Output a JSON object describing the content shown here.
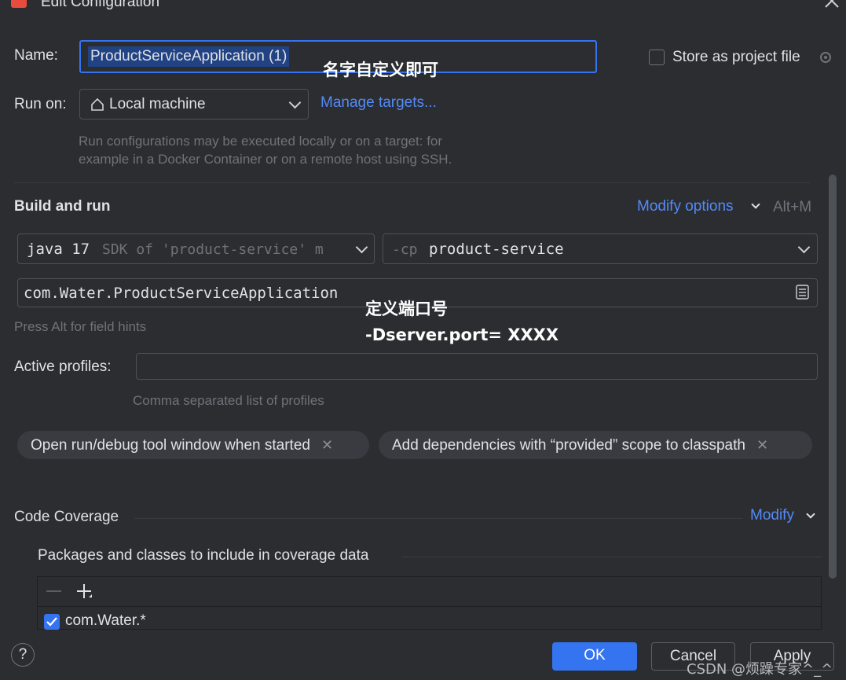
{
  "window": {
    "title": "Edit Configuration"
  },
  "name_field": {
    "label": "Name:",
    "value": "ProductServiceApplication (1)"
  },
  "store_option": {
    "label": "Store as project file"
  },
  "run_on": {
    "label": "Run on:",
    "value": "Local machine",
    "manage_link": "Manage targets...",
    "hint_line1": "Run configurations may be executed locally or on a target: for",
    "hint_line2": "example in a Docker Container or on a remote host using SSH."
  },
  "build_run": {
    "title": "Build and run",
    "modify_options": "Modify options",
    "shortcut": "Alt+M",
    "jdk_value": "java 17",
    "jdk_hint": "SDK of 'product-service' m",
    "cp_prefix": "-cp",
    "cp_value": "product-service",
    "main_class": "com.Water.ProductServiceApplication",
    "field_hint": "Press Alt for field hints"
  },
  "profiles": {
    "label": "Active profiles:",
    "value": "",
    "hint": "Comma separated list of profiles"
  },
  "chips": [
    {
      "label": "Open run/debug tool window when started"
    },
    {
      "label": "Add dependencies with “provided” scope to classpath"
    }
  ],
  "coverage": {
    "title": "Code Coverage",
    "modify": "Modify",
    "packages_title": "Packages and classes to include in coverage data",
    "items": [
      {
        "label": "com.Water.*",
        "checked": true
      }
    ]
  },
  "annotations": {
    "name_note": "名字自定义即可",
    "port_note_title": "定义端口号",
    "port_note_value": "-Dserver.port= XXXX"
  },
  "footer": {
    "help": "?",
    "ok": "OK",
    "cancel": "Cancel",
    "apply": "Apply"
  },
  "watermark": "CSDN @烦躁专家^_^",
  "colors": {
    "accent": "#3574f0",
    "link": "#548af7",
    "background": "#2b2d30"
  }
}
